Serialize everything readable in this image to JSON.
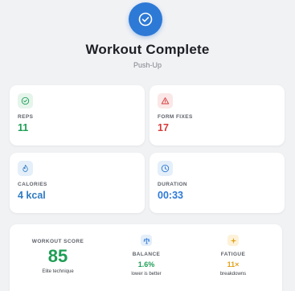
{
  "header": {
    "title": "Workout Complete",
    "exercise": "Push-Up",
    "accent": "#2d79d6"
  },
  "stats": [
    {
      "icon": "check-circle-icon",
      "label": "REPS",
      "value": "11",
      "color": "#1e9d56"
    },
    {
      "icon": "warning-triangle-icon",
      "label": "FORM FIXES",
      "value": "17",
      "color": "#d63a3a"
    },
    {
      "icon": "flame-icon",
      "label": "CALORIES",
      "value": "4 kcal",
      "color": "#2f7bc2"
    },
    {
      "icon": "clock-icon",
      "label": "DURATION",
      "value": "00:33",
      "color": "#2d79d6"
    }
  ],
  "summary": {
    "score_label": "WORKOUT SCORE",
    "score_value": "85",
    "score_caption": "Elite technique",
    "balance": {
      "icon": "balance-icon",
      "label": "BALANCE",
      "value": "1.6%",
      "caption": "lower is better",
      "color": "#1e9d56"
    },
    "fatigue": {
      "icon": "sparkle-icon",
      "label": "FATIGUE",
      "value": "11×",
      "caption": "breakdowns",
      "color": "#e0a21a"
    }
  }
}
